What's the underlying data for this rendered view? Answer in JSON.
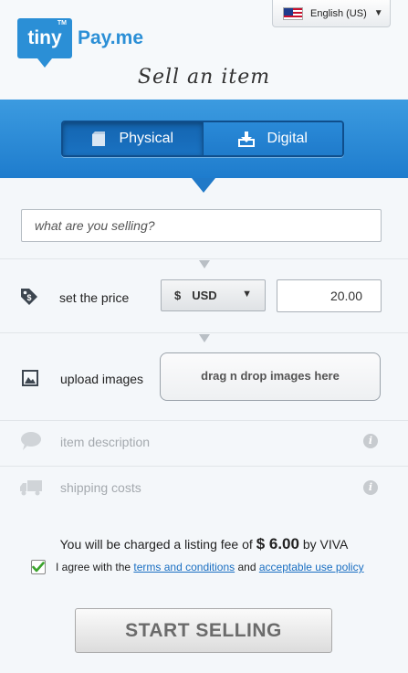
{
  "header": {
    "logo_tiny": "tiny",
    "logo_tm": "TM",
    "logo_pay": "Pay.me",
    "language": "English (US)",
    "tagline": "Sell an item"
  },
  "item_type": {
    "options": [
      "Physical",
      "Digital"
    ],
    "selected": "Physical"
  },
  "search": {
    "placeholder": "what are you selling?",
    "value": ""
  },
  "price": {
    "label": "set the price",
    "currency_symbol": "$",
    "currency": "USD",
    "amount": "20.00"
  },
  "images": {
    "label": "upload images",
    "dropzone": "drag n drop images here"
  },
  "description": {
    "label": "item description"
  },
  "shipping": {
    "label": "shipping costs"
  },
  "fee": {
    "prefix": "You will be charged a listing fee of",
    "amount": "$ 6.00",
    "suffix": "by VIVA"
  },
  "agreement": {
    "checked": true,
    "prefix": "I agree with the",
    "terms_link": "terms and conditions",
    "and": "and",
    "aup_link": "acceptable use policy"
  },
  "cta": {
    "label": "START SELLING"
  },
  "colors": {
    "brand_blue": "#2b8fd6",
    "link": "#1a6fc2",
    "check_green": "#3aa32c"
  }
}
